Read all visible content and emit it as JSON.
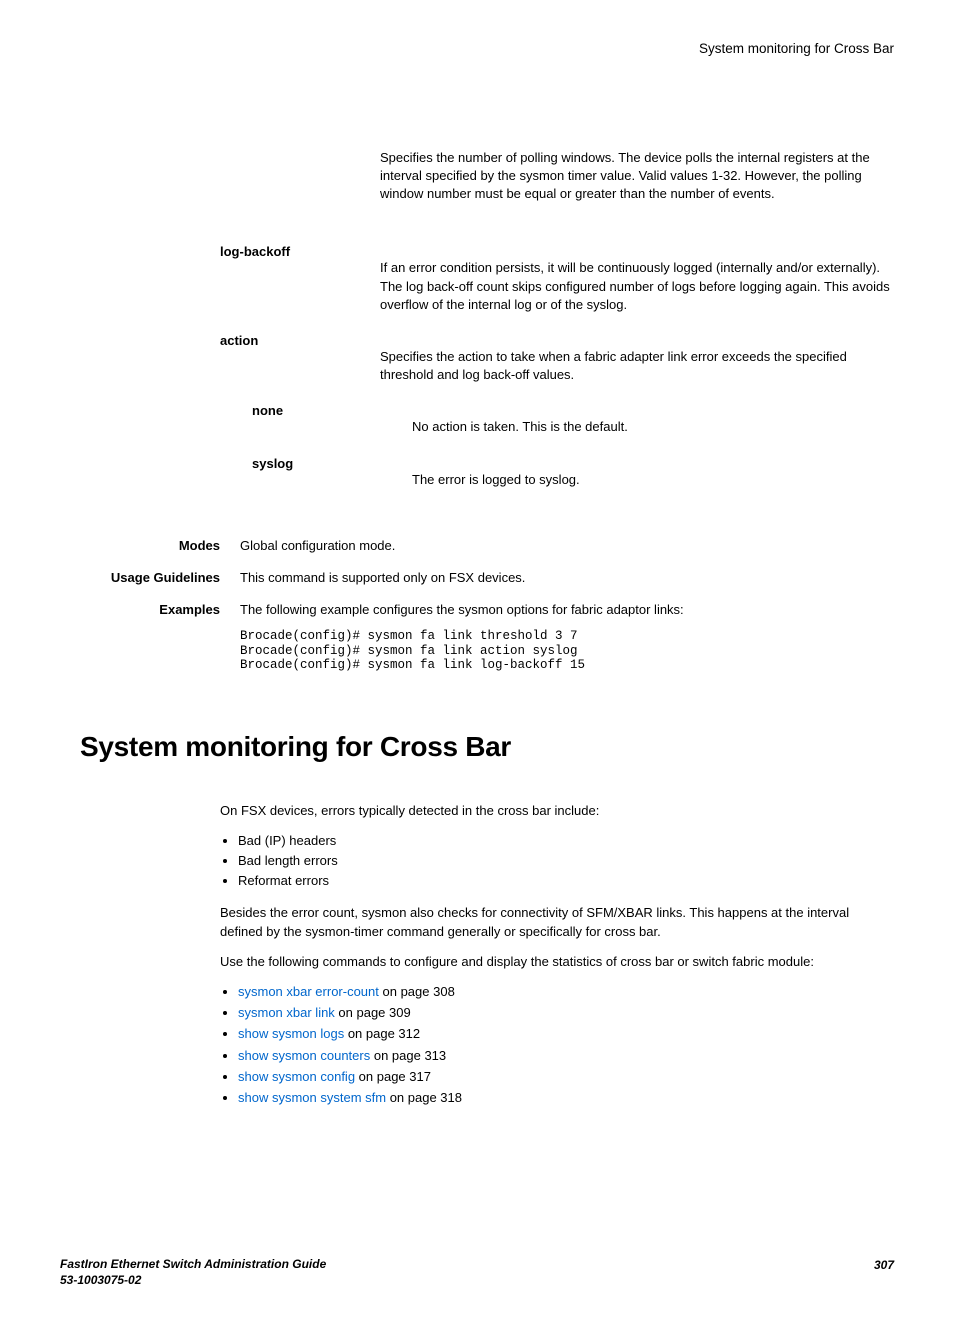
{
  "header": {
    "title": "System monitoring for Cross Bar"
  },
  "params": {
    "first_desc": "Specifies the number of polling windows. The device polls the internal registers at the interval specified by the sysmon timer value. Valid values 1-32. However, the polling window number must be equal or greater than the number of events.",
    "log_backoff": {
      "label": "log-backoff",
      "desc": "If an error condition persists, it will be continuously logged (internally and/or externally). The log back-off count skips configured number of logs before logging again. This avoids overflow of the internal log or of the syslog."
    },
    "action": {
      "label": "action",
      "desc": "Specifies the action to take when a fabric adapter link error exceeds the specified threshold and log back-off values."
    },
    "none": {
      "label": "none",
      "desc": "No action is taken. This is the default."
    },
    "syslog": {
      "label": "syslog",
      "desc": "The error is logged to syslog."
    }
  },
  "sections": {
    "modes": {
      "label": "Modes",
      "content": "Global configuration mode."
    },
    "usage": {
      "label": "Usage Guidelines",
      "content": "This command is supported only on FSX devices."
    },
    "examples": {
      "label": "Examples",
      "intro": "The following example configures the sysmon options for fabric adaptor links:",
      "code": "Brocade(config)# sysmon fa link threshold 3 7\nBrocade(config)# sysmon fa link action syslog\nBrocade(config)# sysmon fa link log-backoff 15"
    }
  },
  "section2": {
    "title": "System monitoring for Cross Bar",
    "p1": "On FSX devices, errors typically detected in the cross bar include:",
    "bullets1": [
      "Bad (IP) headers",
      "Bad length errors",
      "Reformat errors"
    ],
    "p2": "Besides the error count, sysmon also checks for connectivity of SFM/XBAR links. This happens at the interval defined by the sysmon-timer command generally or specifically for cross bar.",
    "p3": "Use the following commands to configure and display the statistics of cross bar or switch fabric module:",
    "links": [
      {
        "text": "sysmon xbar error-count",
        "suffix": " on page 308"
      },
      {
        "text": "sysmon xbar link",
        "suffix": " on page 309"
      },
      {
        "text": "show sysmon logs",
        "suffix": " on page 312"
      },
      {
        "text": "show sysmon counters",
        "suffix": " on page 313"
      },
      {
        "text": "show sysmon config",
        "suffix": " on page 317"
      },
      {
        "text": "show sysmon system sfm",
        "suffix": " on page 318"
      }
    ]
  },
  "footer": {
    "line1": "FastIron Ethernet Switch Administration Guide",
    "line2": "53-1003075-02",
    "page": "307"
  }
}
